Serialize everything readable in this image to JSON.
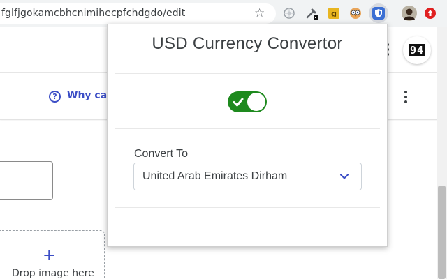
{
  "browser": {
    "url": "fglfjgokamcbhcnimihecpfchdgdo/edit",
    "bookmark_icon": "star-icon",
    "extensions": [
      {
        "name": "web-icon"
      },
      {
        "name": "eyedropper-icon"
      },
      {
        "name": "g-extension-icon",
        "label": "g"
      },
      {
        "name": "owl-icon"
      },
      {
        "name": "shield-extension-icon"
      },
      {
        "name": "profile-avatar"
      },
      {
        "name": "upload-icon"
      }
    ]
  },
  "page": {
    "badge": "94",
    "help_text": "Why can'",
    "drop_text": "Drop image here",
    "plus_glyph": "+"
  },
  "popup": {
    "title": "USD Currency Convertor",
    "toggle_on": true,
    "convert_label": "Convert To",
    "selected_currency": "United Arab Emirates Dirham"
  },
  "colors": {
    "accent": "#3c4ec6",
    "toggle_on": "#1e8a1e",
    "text": "#3c4043"
  }
}
